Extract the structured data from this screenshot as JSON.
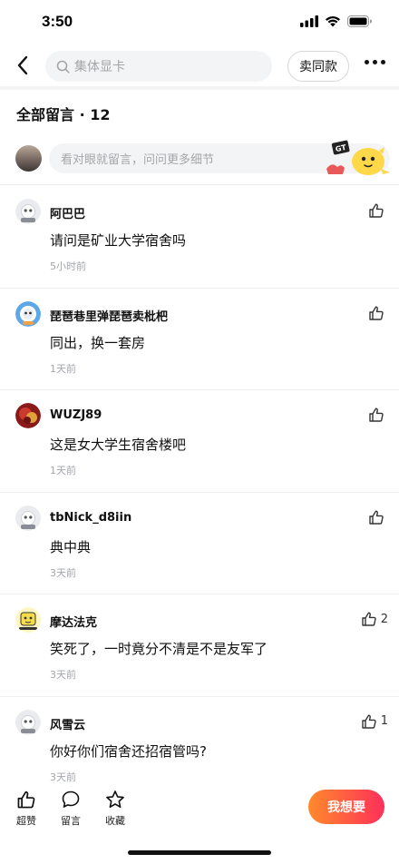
{
  "status_bar": {
    "time": "3:50"
  },
  "nav": {
    "search_placeholder": "集体显卡",
    "sell_same_label": "卖同款"
  },
  "comments": {
    "title": "全部留言 · 12",
    "input_placeholder": "看对眼就留言，问问更多细节",
    "items": [
      {
        "username": "阿巴巴",
        "text": "请问是矿业大学宿舍吗",
        "time": "5小时前",
        "likes": ""
      },
      {
        "username": "琵琶巷里弹琵琶卖枇杷",
        "text": "同出，换一套房",
        "time": "1天前",
        "likes": ""
      },
      {
        "username": "WUZJ89",
        "text": "这是女大学生宿舍楼吧",
        "time": "1天前",
        "likes": ""
      },
      {
        "username": "tbNick_d8iin",
        "text": "典中典",
        "time": "3天前",
        "likes": ""
      },
      {
        "username": "摩达法克",
        "text": "笑死了，一时竟分不清是不是友军了",
        "time": "3天前",
        "likes": "2"
      },
      {
        "username": "风雪云",
        "text": "你好你们宿舍还招宿管吗?",
        "time": "3天前",
        "likes": "1"
      }
    ]
  },
  "bottom_bar": {
    "like_label": "超赞",
    "comment_label": "留言",
    "favorite_label": "收藏",
    "want_label": "我想要"
  },
  "colors": {
    "accent_start": "#ff8a2b",
    "accent_end": "#ff2f5a",
    "muted_text": "#a4a6ab",
    "input_bg": "#f3f4f6"
  }
}
